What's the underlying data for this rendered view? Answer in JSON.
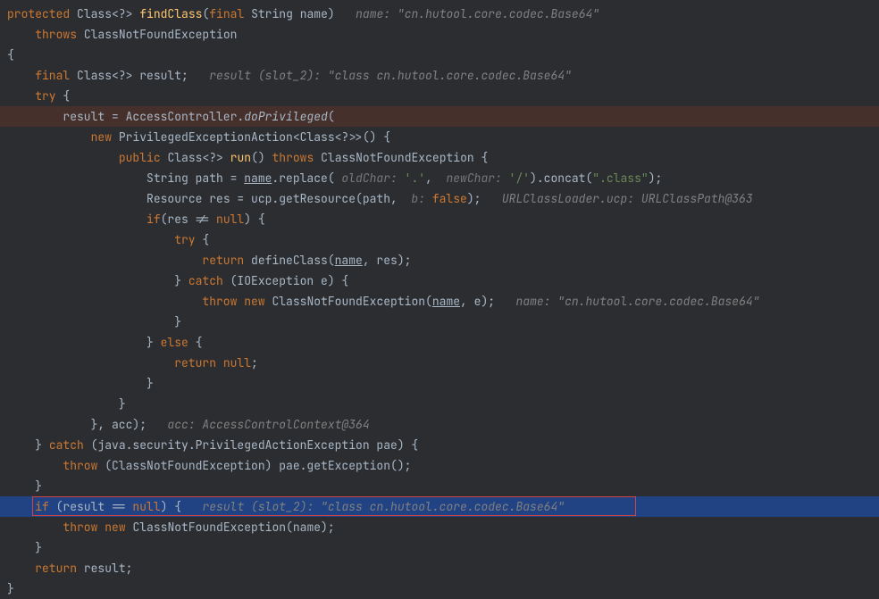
{
  "colors": {
    "keyword": "#cc7832",
    "string": "#6a8759",
    "method": "#ffc66d",
    "comment": "#808080",
    "paramHint": "#787878",
    "selectionBg": "#214283",
    "errorBg": "#45302b",
    "boxBorder": "#cc4444"
  },
  "kw": {
    "protected": "protected",
    "final": "final",
    "throws": "throws",
    "try": "try",
    "catch": "catch",
    "new": "new",
    "public": "public",
    "if": "if",
    "else": "else",
    "return": "return",
    "throw": "throw",
    "null": "null",
    "false": "false"
  },
  "sig": {
    "classType": "Class<?>",
    "methodName": "findClass",
    "paramType": "String",
    "paramName": "name",
    "hint": "name: \"cn.hutool.core.codec.Base64\"",
    "throwsType": "ClassNotFoundException"
  },
  "l1": {
    "resultDecl": "Class<?> result;",
    "hint": "result (slot_2): \"class cn.hutool.core.codec.Base64\""
  },
  "l2": {
    "assign": "result = AccessController.",
    "call": "doPrivileged",
    "open": "("
  },
  "l3": {
    "text1": " PrivilegedExceptionAction<Class<?>>() {"
  },
  "l4": {
    "retType": "Class<?>",
    "runName": "run",
    "parens": "()",
    "throwsType": "ClassNotFoundException {"
  },
  "l5": {
    "decl": "String path = ",
    "nameRef": "name",
    "replace": ".replace(",
    "oldCharLbl": " oldChar: ",
    "oldCharVal": "'.'",
    "comma": ", ",
    "newCharLbl": " newChar: ",
    "newCharVal": "'/'",
    "concat": ").concat(",
    "classStr": "\".class\"",
    "end": ");"
  },
  "l6": {
    "decl": "Resource res = ucp.getResource(path, ",
    "bLbl": " b: ",
    "end": ");",
    "hint": "URLClassLoader.ucp: URLClassPath@363"
  },
  "l7": {
    "text": "(res != "
  },
  "l8": {
    "text": " {"
  },
  "l9": {
    "pre": " defineClass(",
    "nameRef": "name",
    "post": ", res);"
  },
  "l10": {
    "text": " (IOException e) {"
  },
  "l11": {
    "pre": " ClassNotFoundException(",
    "nameRef": "name",
    "post": ", e);",
    "hint": "name: \"cn.hutool.core.codec.Base64\""
  },
  "l12": {
    "brace": "}"
  },
  "l13": {
    "text": " {"
  },
  "l14": {
    "semi": ";"
  },
  "l15": {
    "brace": "}"
  },
  "l16": {
    "brace": "}"
  },
  "l17": {
    "closer": "}, acc);",
    "hint": "acc: AccessControlContext@364"
  },
  "l18": {
    "text": " (java.security.PrivilegedActionException pae) {"
  },
  "l19": {
    "text": " (ClassNotFoundException) pae.getException();"
  },
  "l20": {
    "brace": "}"
  },
  "l21": {
    "cond": " (result == ",
    "close": ") {",
    "hint": "result (slot_2): \"class cn.hutool.core.codec.Base64\""
  },
  "l22": {
    "text": " ClassNotFoundException(name);"
  },
  "l23": {
    "brace": "}"
  },
  "l24": {
    "text": " result;"
  },
  "l25": {
    "brace": "}"
  }
}
